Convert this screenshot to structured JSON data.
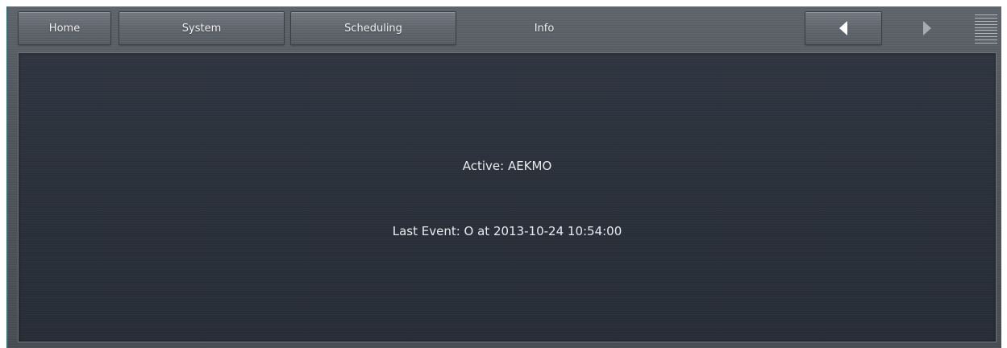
{
  "topbar": {
    "tabs": [
      {
        "label": "Home"
      },
      {
        "label": "System"
      },
      {
        "label": "Scheduling"
      },
      {
        "label": "Info"
      }
    ],
    "prev_icon": "triangle-left-icon",
    "next_icon": "triangle-right-icon",
    "menu_icon": "hamburger-menu-icon"
  },
  "panel": {
    "active_text": "Active: AEKMO",
    "last_event_text": "Last Event: O at 2013-10-24 10:54:00"
  },
  "colors": {
    "panel_bg": "#2b313b",
    "chrome_bg": "#50565d",
    "text": "#e8ebee",
    "accent_edge": "#2e6f78"
  }
}
